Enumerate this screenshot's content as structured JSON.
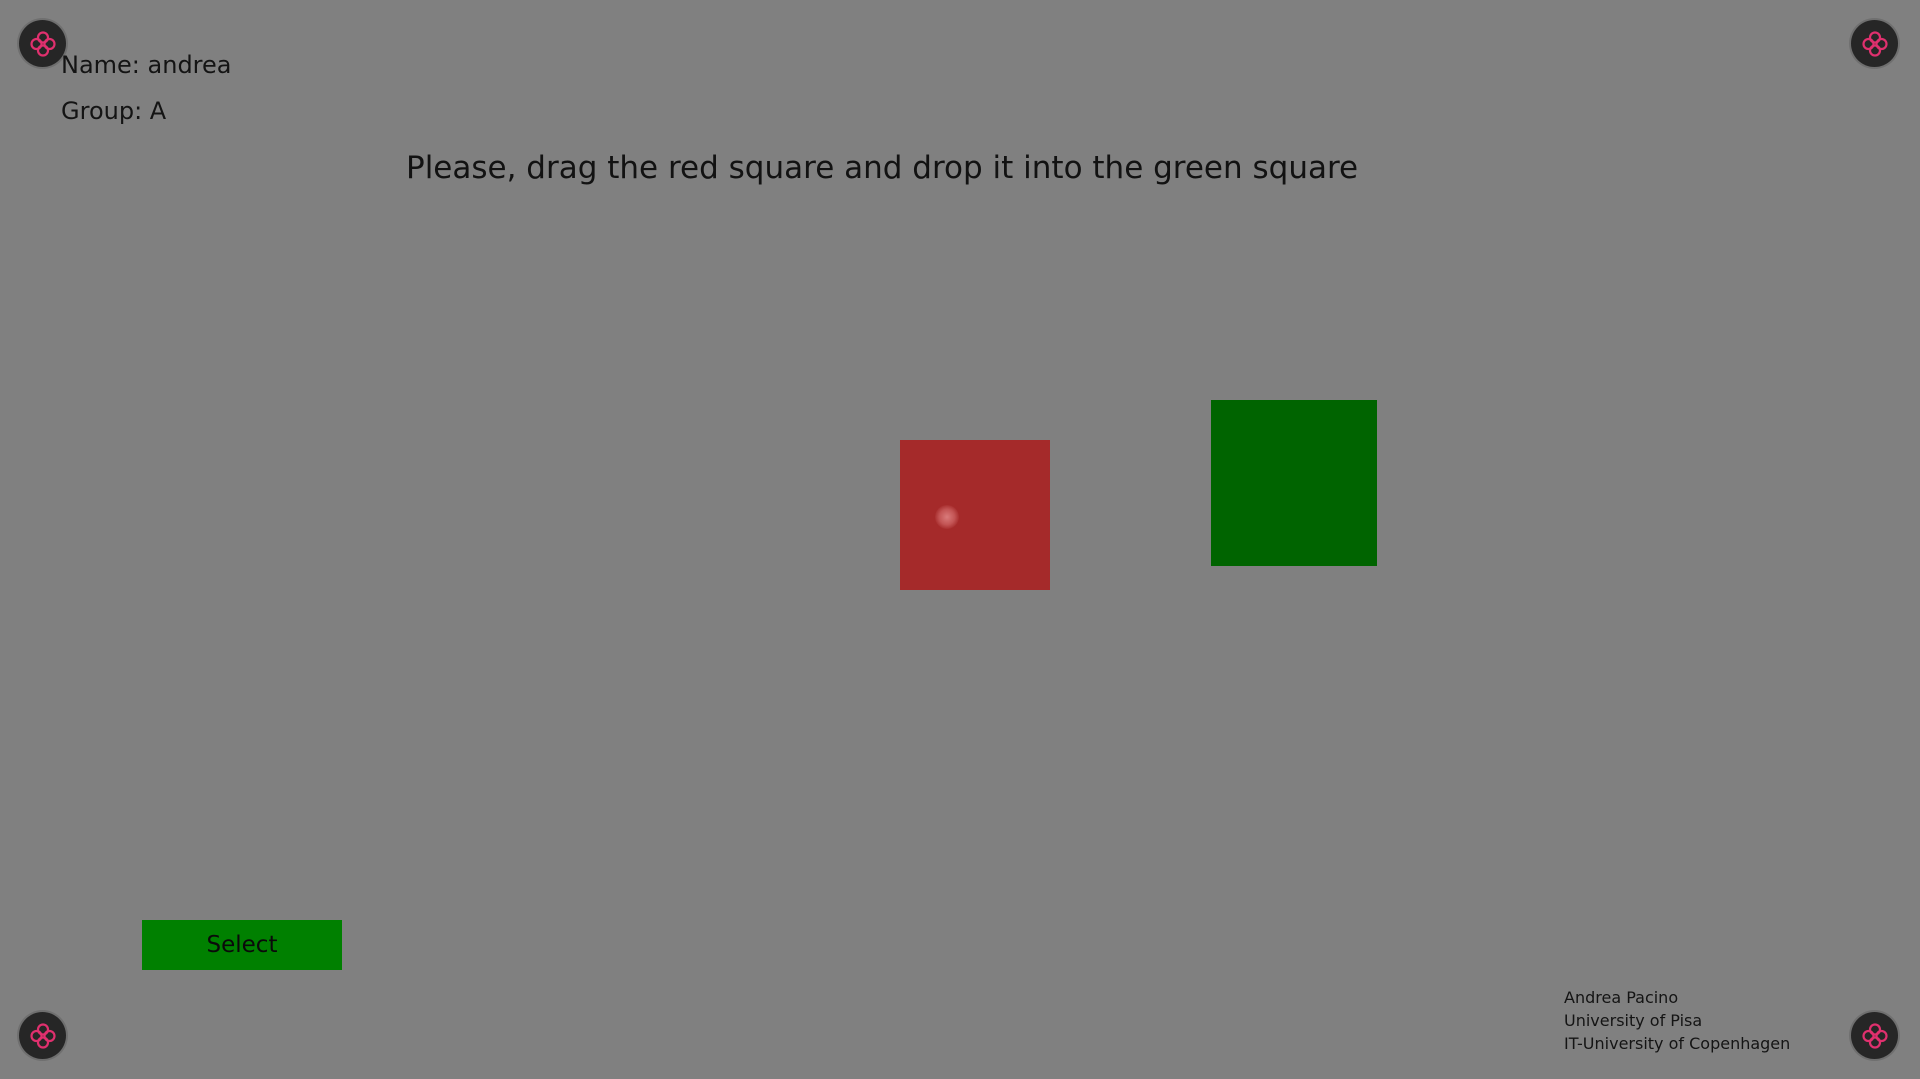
{
  "user": {
    "name_text": "Name: andrea",
    "group_text": "Group: A"
  },
  "task": {
    "instruction": "Please, drag the red square and drop it into the green square"
  },
  "targets": {
    "draggable_color": "#a52a2a",
    "dropzone_color": "#006400"
  },
  "select_button": {
    "label": "Select",
    "color": "#008000"
  },
  "credits": {
    "line1": "Andrea Pacino",
    "line2": "University of Pisa",
    "line3": "IT-University of Copenhagen"
  },
  "corner_markers": {
    "icon": "pink-flower-icon",
    "icon_color": "#e0306e",
    "background_color": "#262626"
  },
  "background_color": "#808080"
}
